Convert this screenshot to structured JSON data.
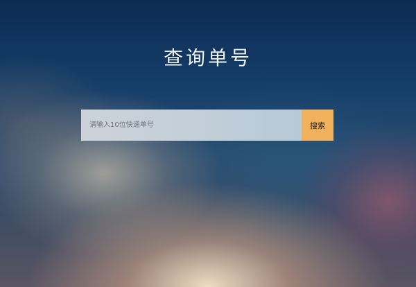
{
  "page": {
    "title": "查询单号"
  },
  "search": {
    "placeholder": "请输入10位快递单号",
    "value": "",
    "button_label": "搜索"
  },
  "colors": {
    "button": "#f2b15c",
    "title_text": "#f2f4f7"
  }
}
